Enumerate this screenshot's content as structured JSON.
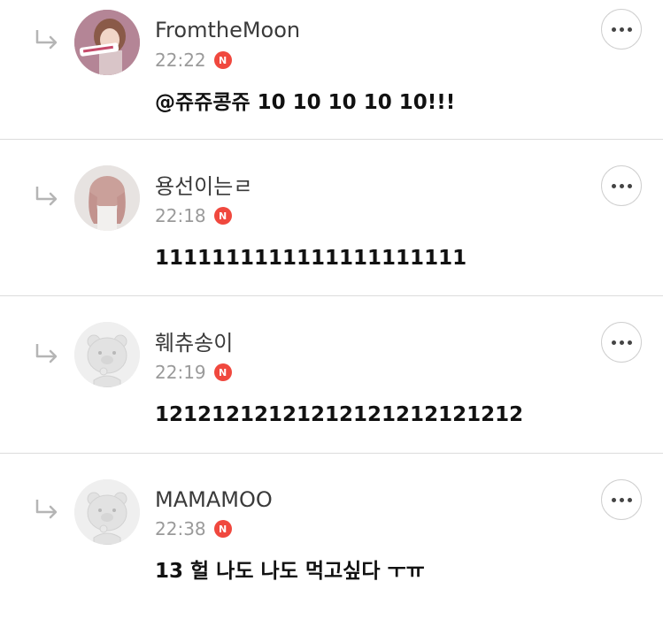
{
  "comments": [
    {
      "username": "FromtheMoon",
      "time": "22:22",
      "badge": "N",
      "text": "@쥬쥬콩쥬  10 10 10 10 10!!!",
      "avatar": "photo-avatar"
    },
    {
      "username": "용선이는ㄹ",
      "time": "22:18",
      "badge": "N",
      "text": "1111111111111111111111",
      "avatar": "photo-avatar"
    },
    {
      "username": "훼츄송이",
      "time": "22:19",
      "badge": "N",
      "text": "12121212121212121212121212",
      "avatar": "default-bear-avatar"
    },
    {
      "username": "MAMAMOO",
      "time": "22:38",
      "badge": "N",
      "text": "13 헐 나도 나도 먹고싶다 ㅜㅠ",
      "avatar": "default-bear-avatar"
    }
  ],
  "colors": {
    "badge": "#f0483e",
    "username": "#3a3a3a",
    "time": "#9a9a9a",
    "divider": "#dcdcdc"
  },
  "icons": {
    "reply": "reply-arrow-icon",
    "more": "more-options-icon"
  }
}
